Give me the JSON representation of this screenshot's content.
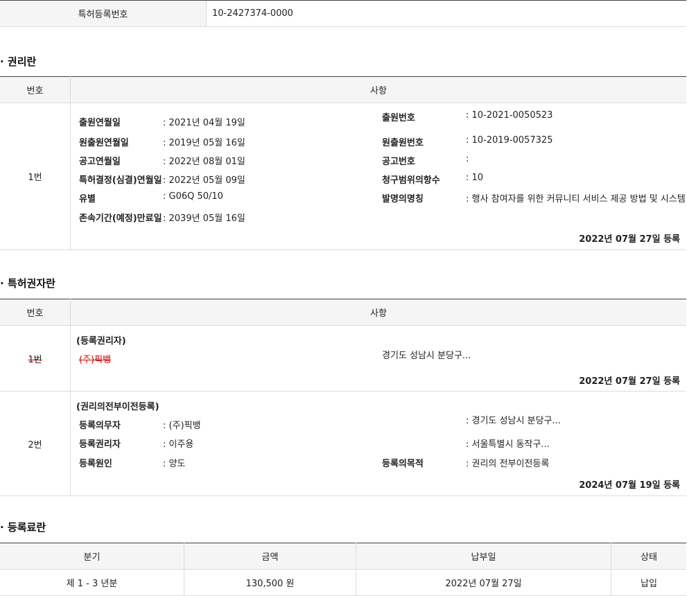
{
  "top": {
    "label": "특허등록번호",
    "value": "10-2427374-0000"
  },
  "rights": {
    "title": "· 권리란",
    "col_num": "번호",
    "col_item": "사항",
    "row": {
      "num": "1번",
      "left": [
        {
          "k": "출원연월일",
          "v": ": 2021년 04월 19일"
        },
        {
          "k": "원출원연월일",
          "v": ": 2019년 05월 16일"
        },
        {
          "k": "공고연월일",
          "v": ": 2022년 08월 01일"
        },
        {
          "k": "특허결정(심결)연월일",
          "v": ": 2022년 05월 09일"
        },
        {
          "k": "유별",
          "v": ": G06Q 50/10"
        },
        {
          "k": "존속기간(예정)만료일",
          "v": ": 2039년 05월 16일"
        }
      ],
      "right": [
        {
          "k": "출원번호",
          "v": ": 10-2021-0050523"
        },
        {
          "k": "원출원번호",
          "v": ": 10-2019-0057325"
        },
        {
          "k": "공고번호",
          "v": ":"
        },
        {
          "k": "청구범위의항수",
          "v": ": 10"
        },
        {
          "k": "발명의명칭",
          "v": ": 행사 참여자를 위한 커뮤니티 서비스 제공 방법 및 시스템"
        }
      ],
      "reg": "2022년 07월 27일 등록"
    }
  },
  "holders": {
    "title": "· 특허권자란",
    "col_num": "번호",
    "col_item": "사항",
    "row1": {
      "num": "1번",
      "kind": "(등록권리자)",
      "name": "(주)픽뱅",
      "addr": "경기도 성남시 분당구...",
      "reg": "2022년 07월 27일 등록"
    },
    "row2": {
      "num": "2번",
      "kind": "(권리의전부이전등록)",
      "items": [
        {
          "k": "등록의무자",
          "v": ": (주)픽뱅"
        },
        {
          "k": "등록권리자",
          "v": ": 이주용"
        },
        {
          "k": "등록원인",
          "v": ": 양도"
        }
      ],
      "addr1": ": 경기도 성남시 분당구...",
      "addr2": ": 서울특별시 동작구...",
      "purpose_k": "등록의목적",
      "purpose_v": ": 권리의 전부이전등록",
      "reg": "2024년 07월 19일 등록"
    }
  },
  "fees": {
    "title": "· 등록료란",
    "headers": [
      "분기",
      "금액",
      "납부일",
      "상태"
    ],
    "row": [
      "제 1 - 3 년분",
      "130,500 원",
      "2022년 07월 27일",
      "납입"
    ]
  }
}
